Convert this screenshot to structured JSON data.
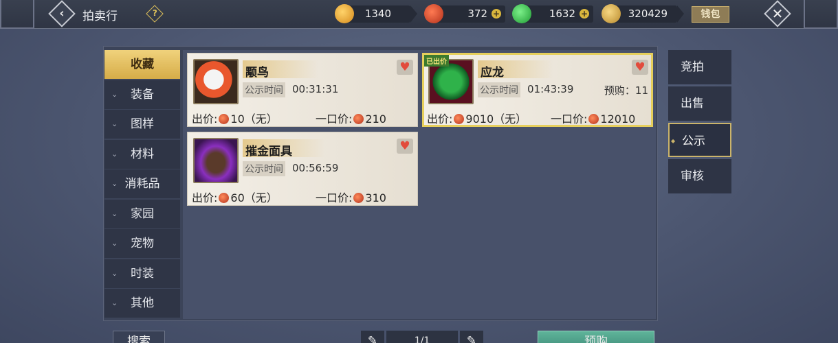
{
  "header": {
    "back_icon": "chevron-left-icon",
    "title": "拍卖行",
    "help_icon": "question-diamond-icon",
    "currencies": [
      {
        "icon": "gold-coin-icon",
        "value": "1340",
        "color": "#e6a62b"
      },
      {
        "icon": "red-jade-icon",
        "value": "372",
        "color": "#d9442a"
      },
      {
        "icon": "green-jade-icon",
        "value": "1632",
        "color": "#3bbf4d"
      },
      {
        "icon": "silver-ingot-icon",
        "value": "320429",
        "color": "#e0b04a"
      }
    ],
    "plus_glyph": "+",
    "wallet_label": "钱包",
    "close_icon": "close-x-icon"
  },
  "categories": [
    {
      "label": "收藏",
      "active": true
    },
    {
      "label": "装备"
    },
    {
      "label": "图样"
    },
    {
      "label": "材料"
    },
    {
      "label": "消耗品"
    },
    {
      "label": "家园"
    },
    {
      "label": "宠物"
    },
    {
      "label": "时装"
    },
    {
      "label": "其他"
    }
  ],
  "items": [
    {
      "name": "颙鸟",
      "pub_label": "公示时间",
      "pub_time": "00:31:31",
      "price_text": "出价:",
      "price": "10（无）",
      "buyout_text": "一口价:",
      "buyout": "210",
      "thumb_colors": [
        "#e9572d",
        "#f4f4f4"
      ]
    },
    {
      "name": "应龙",
      "sold_tag": "已出价",
      "pub_label": "公示时间",
      "pub_time": "01:43:39",
      "prebuy": "预购：11",
      "price_text": "出价:",
      "price": "9010（无）",
      "buyout_text": "一口价:",
      "buyout": "12010",
      "thumb_colors": [
        "#1f8f3a",
        "#0c3c16"
      ]
    },
    {
      "name": "摧金面具",
      "pub_label": "公示时间",
      "pub_time": "00:56:59",
      "price_text": "出价:",
      "price": "60（无）",
      "buyout_text": "一口价:",
      "buyout": "310",
      "thumb_colors": [
        "#8a2fbf",
        "#3a2230"
      ]
    }
  ],
  "side_tabs": [
    {
      "label": "竞拍"
    },
    {
      "label": "出售"
    },
    {
      "label": "公示",
      "active": true
    },
    {
      "label": "审核"
    }
  ],
  "footer": {
    "search_label": "搜索",
    "prev_icon": "pencil-left-icon",
    "page": "1/1",
    "next_icon": "pencil-right-icon",
    "prebuy_label": "预购"
  }
}
